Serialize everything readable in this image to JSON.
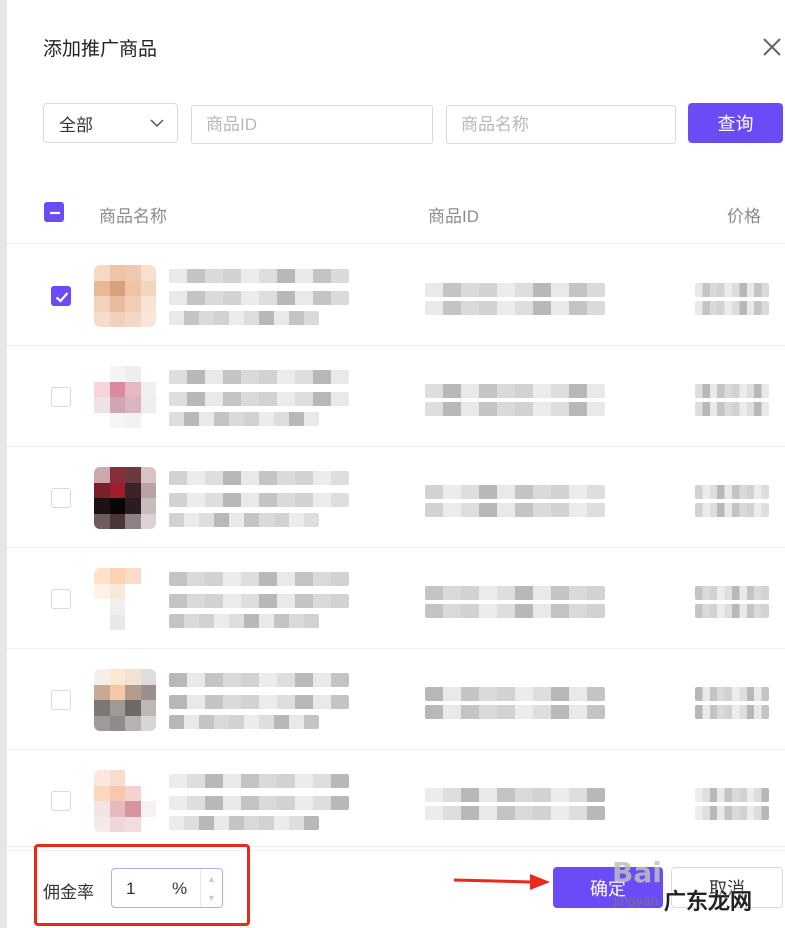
{
  "dialog": {
    "title": "添加推广商品"
  },
  "filters": {
    "category_value": "全部",
    "id_placeholder": "商品ID",
    "name_placeholder": "商品名称",
    "query_label": "查询"
  },
  "table": {
    "columns": {
      "name": "商品名称",
      "id": "商品ID",
      "price": "价格"
    },
    "rows": [
      {
        "checked": true,
        "content": "blurred"
      },
      {
        "checked": false,
        "content": "blurred"
      },
      {
        "checked": false,
        "content": "blurred"
      },
      {
        "checked": false,
        "content": "blurred"
      },
      {
        "checked": false,
        "content": "blurred"
      },
      {
        "checked": false,
        "content": "blurred"
      }
    ]
  },
  "footer": {
    "commission_label": "佣金率",
    "commission_value": "1",
    "commission_unit": "%",
    "confirm_label": "确定",
    "cancel_label": "取消"
  },
  "watermark": {
    "brand": "Bai",
    "brand_sub": "jingyan",
    "site": "广东龙网"
  },
  "colors": {
    "accent": "#6a4bf6",
    "annotation": "#e8291c"
  },
  "icons": [
    "close-icon",
    "chevron-down-icon",
    "check-icon",
    "minus-icon",
    "arrow-right-icon"
  ]
}
